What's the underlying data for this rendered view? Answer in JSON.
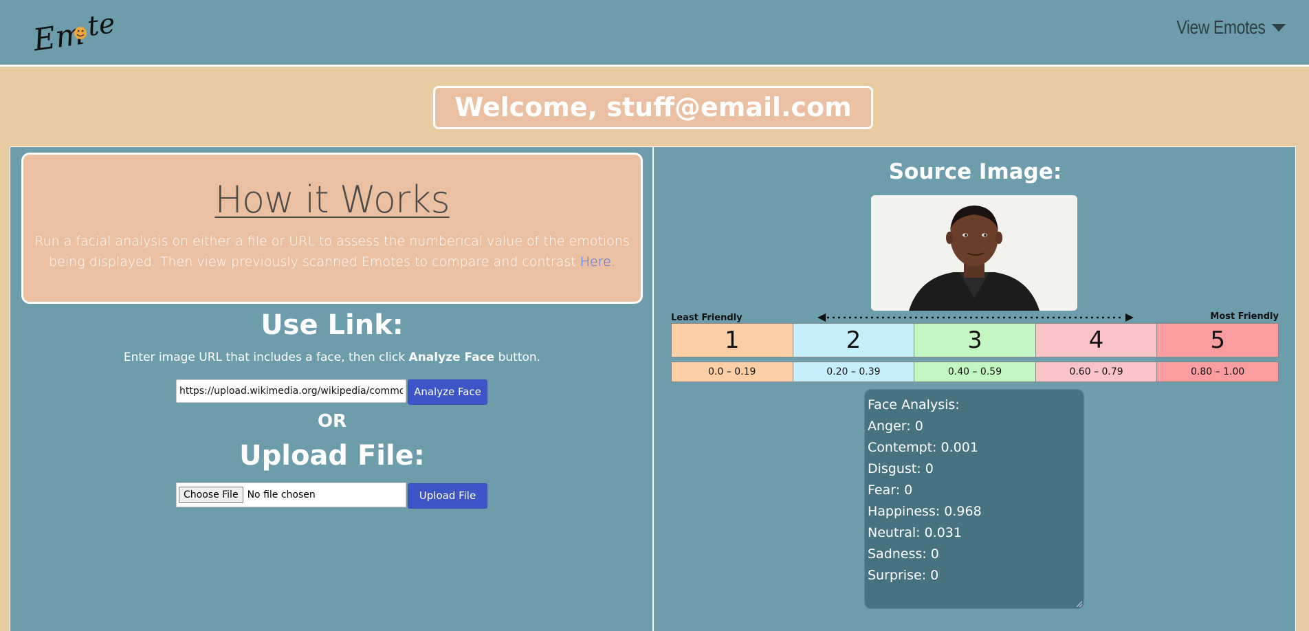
{
  "navbar": {
    "logo_text": "Emote",
    "dropdown_label": "View Emotes"
  },
  "welcome": "Welcome, stuff@email.com",
  "how_it_works": {
    "title": "How it Works",
    "text": "Run a facial analysis on either a file or URL to assess the numberical value of the emotions being displayed. Then view previously scanned Emotes to compare and contrast ",
    "link_label": "Here."
  },
  "use_link": {
    "title": "Use Link:",
    "desc_before": "Enter image URL that includes a face, then click ",
    "desc_bold": "Analyze Face",
    "desc_after": " button.",
    "input_value": "https://upload.wikimedia.org/wikipedia/commons/",
    "button_label": "Analyze Face"
  },
  "or_label": "OR",
  "upload": {
    "title": "Upload File:",
    "choose_label": "Choose File",
    "no_file_label": "No file chosen",
    "button_label": "Upload File"
  },
  "source": {
    "title": "Source Image:"
  },
  "scale": {
    "least_label": "Least Friendly",
    "most_label": "Most Friendly",
    "levels": [
      "1",
      "2",
      "3",
      "4",
      "5"
    ],
    "ranges": [
      "0.0 – 0.19",
      "0.20 – 0.39",
      "0.40 – 0.59",
      "0.60 – 0.79",
      "0.80 – 1.00"
    ],
    "colors": [
      "#fccfa6",
      "#c6eefb",
      "#c4f6c2",
      "#fac3c8",
      "#f99da0"
    ]
  },
  "analysis": {
    "heading": "Face Analysis:",
    "lines": [
      "Anger: 0",
      "Contempt: 0.001",
      "Disgust: 0",
      "Fear: 0",
      "Happiness: 0.968",
      "Neutral: 0.031",
      "Sadness: 0",
      "Surprise: 0"
    ]
  },
  "colors": {
    "nav_bg": "#6d9dab",
    "page_bg": "#e8cba0",
    "card_bg": "#ebbfa2",
    "button_bg": "#3e55c8",
    "analysis_bg": "#477380"
  }
}
